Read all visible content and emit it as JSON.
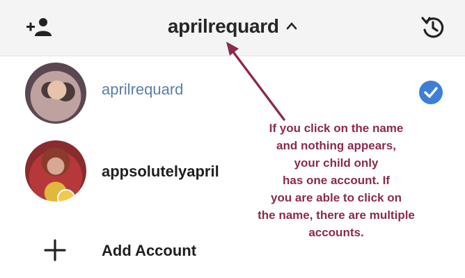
{
  "header": {
    "title": "aprilrequard",
    "icons": {
      "add_person": "add-person-icon",
      "caret": "chevron-up-icon",
      "history": "history-icon"
    }
  },
  "accounts": [
    {
      "username": "aprilrequard",
      "selected": true,
      "avatar": "avatar-photo"
    },
    {
      "username": "appsolutelyapril",
      "selected": false,
      "avatar": "avatar-photo"
    }
  ],
  "add_account": {
    "label": "Add Account",
    "icon": "plus-icon"
  },
  "annotation": {
    "lines": [
      "If you click on the name",
      "and nothing appears,",
      "your child only",
      "has one account. If",
      "you are able to click on",
      "the name, there are multiple",
      "accounts."
    ]
  },
  "colors": {
    "header_bg": "#f4f4f4",
    "selected_name": "#5b7ea6",
    "check_blue": "#3d7fd6",
    "annotation": "#8a2a4f"
  }
}
